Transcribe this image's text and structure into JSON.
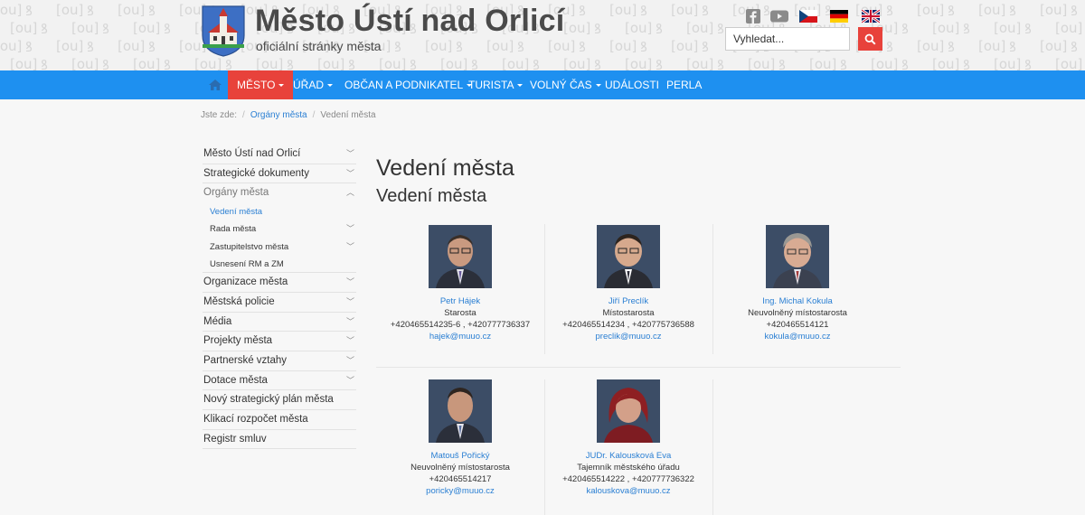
{
  "header": {
    "title": "Město Ústí nad Orlicí",
    "subtitle": "oficiální stránky města",
    "pattern_text": "[ou]",
    "search_placeholder": "Vyhledat..."
  },
  "icons": {
    "social": [
      "facebook-icon",
      "youtube-icon",
      "flag-czech-icon",
      "flag-german-icon",
      "flag-english-icon"
    ],
    "search": "search-icon",
    "home": "home-icon"
  },
  "colors": {
    "nav": "#1e90f0",
    "accent": "#e8423b",
    "link": "#2a7fd3"
  },
  "nav": {
    "items": [
      {
        "label": "MĚSTO",
        "dropdown": true
      },
      {
        "label": "ÚŘAD",
        "dropdown": true
      },
      {
        "label": "OBČAN A PODNIKATEL",
        "dropdown": true
      },
      {
        "label": "TURISTA",
        "dropdown": true
      },
      {
        "label": "VOLNÝ ČAS",
        "dropdown": true
      },
      {
        "label": "UDÁLOSTI",
        "dropdown": false
      },
      {
        "label": "PERLA",
        "dropdown": false
      }
    ]
  },
  "breadcrumb": {
    "prefix": "Jste zde:",
    "items": [
      "Orgány města",
      "Vedení města"
    ]
  },
  "sidebar": {
    "items": [
      {
        "label": "Město Ústí nad Orlicí",
        "chevron": "down"
      },
      {
        "label": "Strategické dokumenty",
        "chevron": "down"
      },
      {
        "label": "Orgány města",
        "chevron": "up"
      },
      {
        "label": "Vedení města",
        "chevron": ""
      },
      {
        "label": "Rada města",
        "chevron": "down"
      },
      {
        "label": "Zastupitelstvo města",
        "chevron": "down"
      },
      {
        "label": "Usnesení RM a ZM",
        "chevron": ""
      },
      {
        "label": "Organizace města",
        "chevron": "down"
      },
      {
        "label": "Městská policie",
        "chevron": "down"
      },
      {
        "label": "Média",
        "chevron": "down"
      },
      {
        "label": "Projekty města",
        "chevron": "down"
      },
      {
        "label": "Partnerské vztahy",
        "chevron": "down"
      },
      {
        "label": "Dotace města",
        "chevron": "down"
      },
      {
        "label": "Nový strategický plán města",
        "chevron": ""
      },
      {
        "label": "Klikací rozpočet města",
        "chevron": ""
      },
      {
        "label": "Registr smluv",
        "chevron": ""
      }
    ]
  },
  "main": {
    "title": "Vedení města",
    "subtitle": "Vedení města",
    "people": [
      {
        "name": "Petr Hájek",
        "role": "Starosta",
        "phone": "+420465514235-6 , +420777736337",
        "email": "hajek@muuo.cz"
      },
      {
        "name": "Jiří Preclík",
        "role": "Místostarosta",
        "phone": "+420465514234 , +420775736588",
        "email": "preclik@muuo.cz"
      },
      {
        "name": "Ing. Michal Kokula",
        "role": "Neuvolněný místostarosta",
        "phone": "+420465514121",
        "email": "kokula@muuo.cz"
      },
      {
        "name": "Matouš Pořický",
        "role": "Neuvolněný místostarosta",
        "phone": "+420465514217",
        "email": "poricky@muuo.cz"
      },
      {
        "name": "JUDr. Kalousková Eva",
        "role": "Tajemník městského úřadu",
        "phone": "+420465514222 , +420777736322",
        "email": "kalouskova@muuo.cz"
      }
    ]
  }
}
